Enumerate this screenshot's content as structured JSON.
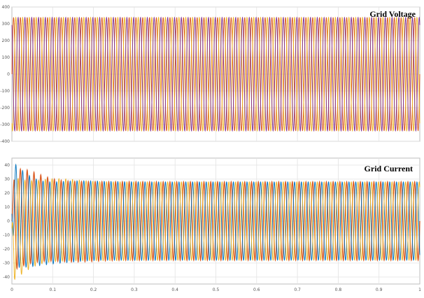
{
  "chart_data": [
    {
      "type": "line",
      "title": "Grid Voltage",
      "xlim": [
        0,
        1
      ],
      "ylim": [
        -400,
        400
      ],
      "yticks": [
        "400",
        "300",
        "200",
        "100",
        "0",
        "-100",
        "-200",
        "-300",
        "-400"
      ],
      "xticks": [],
      "grid": true,
      "waveform": "three-phase sinusoid, constant amplitude",
      "frequency_hz": 60,
      "amplitude": 338,
      "series_colors": [
        "#d95319",
        "#edb120",
        "#7e2f8e"
      ],
      "series": [
        {
          "phase_deg": 0,
          "amplitude": 338
        },
        {
          "phase_deg": -120,
          "amplitude": 338
        },
        {
          "phase_deg": 120,
          "amplitude": 338
        }
      ]
    },
    {
      "type": "line",
      "title": "Grid Current",
      "xlim": [
        0,
        1
      ],
      "ylim": [
        -45,
        45
      ],
      "yticks": [
        "40",
        "30",
        "20",
        "10",
        "0",
        "-10",
        "-20",
        "-30",
        "-40"
      ],
      "xticks": [
        "0",
        "0.1",
        "0.2",
        "0.3",
        "0.4",
        "0.5",
        "0.6",
        "0.7",
        "0.8",
        "0.9",
        "1"
      ],
      "grid": true,
      "waveform": "three-phase sinusoid with start-up transient, settling near 0.2",
      "frequency_hz": 60,
      "steady_amplitude": 28,
      "transient_peak": 38,
      "settling_time": 0.2,
      "series_colors": [
        "#d95319",
        "#0072bd",
        "#edb120"
      ],
      "series": [
        {
          "phase_deg": 0,
          "amplitude": 28
        },
        {
          "phase_deg": -120,
          "amplitude": 28
        },
        {
          "phase_deg": 120,
          "amplitude": 28
        }
      ]
    }
  ]
}
